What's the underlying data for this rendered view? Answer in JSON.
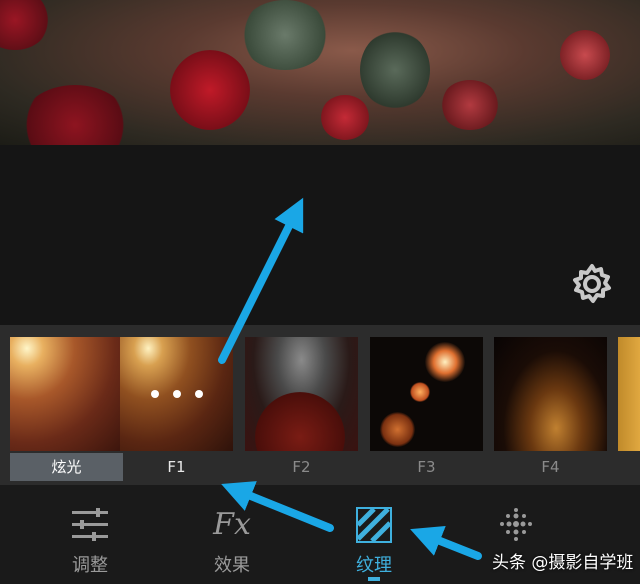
{
  "filters": [
    {
      "name": "炫光",
      "state": "category"
    },
    {
      "name": "F1",
      "state": "selected"
    },
    {
      "name": "F2",
      "state": "normal"
    },
    {
      "name": "F3",
      "state": "normal"
    },
    {
      "name": "F4",
      "state": "normal"
    }
  ],
  "tabs": [
    {
      "label": "调整",
      "icon": "sliders-icon"
    },
    {
      "label": "效果",
      "icon": "fx-icon"
    },
    {
      "label": "纹理",
      "icon": "texture-stripes-icon",
      "active": true
    },
    {
      "label": "",
      "icon": "dot-grid-icon"
    }
  ],
  "watermark": "头条 @摄影自学班",
  "colors": {
    "accent": "#3fb0de",
    "arrow": "#1aa7e6",
    "strip_bg": "#2c2c2c",
    "active_label_bg": "#5a6066"
  }
}
